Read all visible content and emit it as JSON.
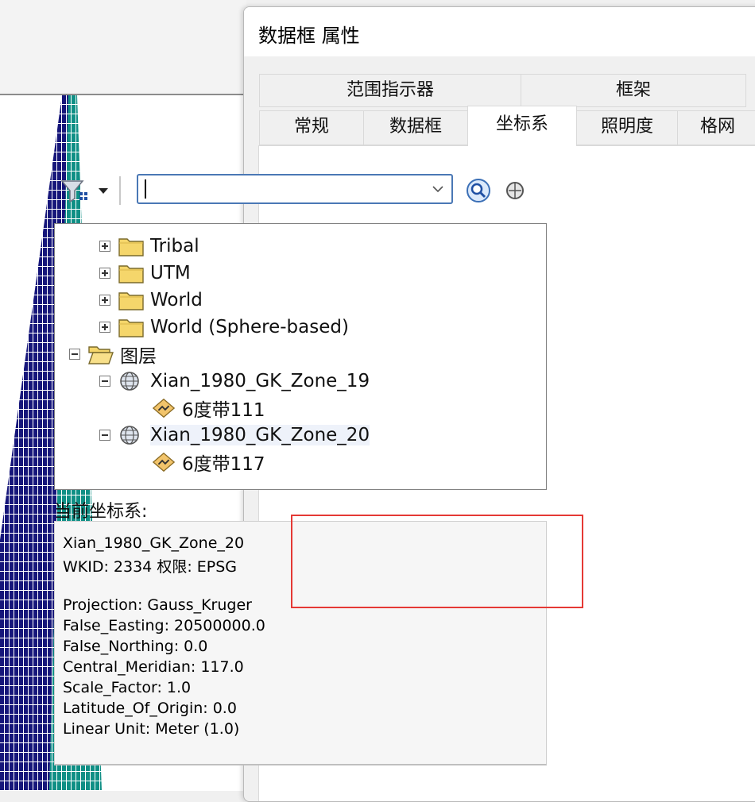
{
  "dialog": {
    "title": "数据框 属性",
    "tabs_row1": [
      "范围指示器",
      "框架"
    ],
    "tabs_row2": [
      "常规",
      "数据框",
      "坐标系",
      "照明度",
      "格网"
    ],
    "active_tab": "坐标系"
  },
  "search": {
    "value": "",
    "placeholder": ""
  },
  "tree": {
    "items": [
      {
        "label": "Tribal",
        "type": "folder",
        "expander": "plus"
      },
      {
        "label": "UTM",
        "type": "folder",
        "expander": "plus"
      },
      {
        "label": "World",
        "type": "folder",
        "expander": "plus"
      },
      {
        "label": "World (Sphere-based)",
        "type": "folder",
        "expander": "plus"
      },
      {
        "label": "图层",
        "type": "folder-open",
        "expander": "minus"
      },
      {
        "label": "Xian_1980_GK_Zone_19",
        "type": "globe",
        "expander": "minus"
      },
      {
        "label": "6度带111",
        "type": "layer"
      },
      {
        "label": "Xian_1980_GK_Zone_20",
        "type": "globe",
        "expander": "minus",
        "selected": true
      },
      {
        "label": "6度带117",
        "type": "layer"
      }
    ]
  },
  "current": {
    "label": "当前坐标系:",
    "lines": [
      "Xian_1980_GK_Zone_20",
      "WKID: 2334 权限: EPSG",
      "",
      "Projection: Gauss_Kruger",
      "False_Easting: 20500000.0",
      "False_Northing: 0.0",
      "Central_Meridian: 117.0",
      "Scale_Factor: 1.0",
      "Latitude_Of_Origin: 0.0",
      "Linear Unit: Meter (1.0)"
    ]
  },
  "colors": {
    "zone_19": "#16167a",
    "zone_20": "#0f8f85",
    "highlight": "#e53935",
    "focus_border": "#4a78b5"
  }
}
